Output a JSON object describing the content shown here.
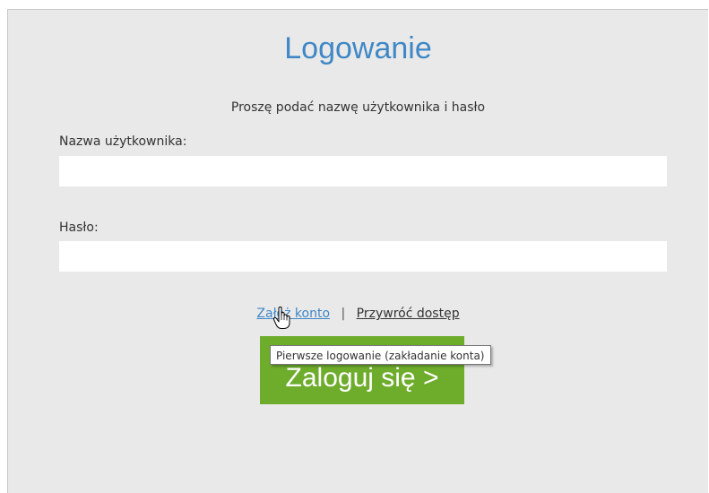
{
  "login": {
    "title": "Logowanie",
    "subtitle": "Proszę podać nazwę użytkownika i hasło",
    "username_label": "Nazwa użytkownika:",
    "username_value": "",
    "password_label": "Hasło:",
    "password_value": "",
    "create_account_link": "Załóż konto",
    "separator": "|",
    "restore_access_link": "Przywróć dostęp",
    "submit_label": "Zaloguj się >",
    "tooltip": "Pierwsze logowanie (zakładanie konta)"
  },
  "colors": {
    "title": "#3f87c6",
    "panel_background": "#e9e9e9",
    "button": "#6eac2c",
    "link": "#3f87c6"
  },
  "icons": {
    "cursor": "hand-pointer-icon"
  }
}
